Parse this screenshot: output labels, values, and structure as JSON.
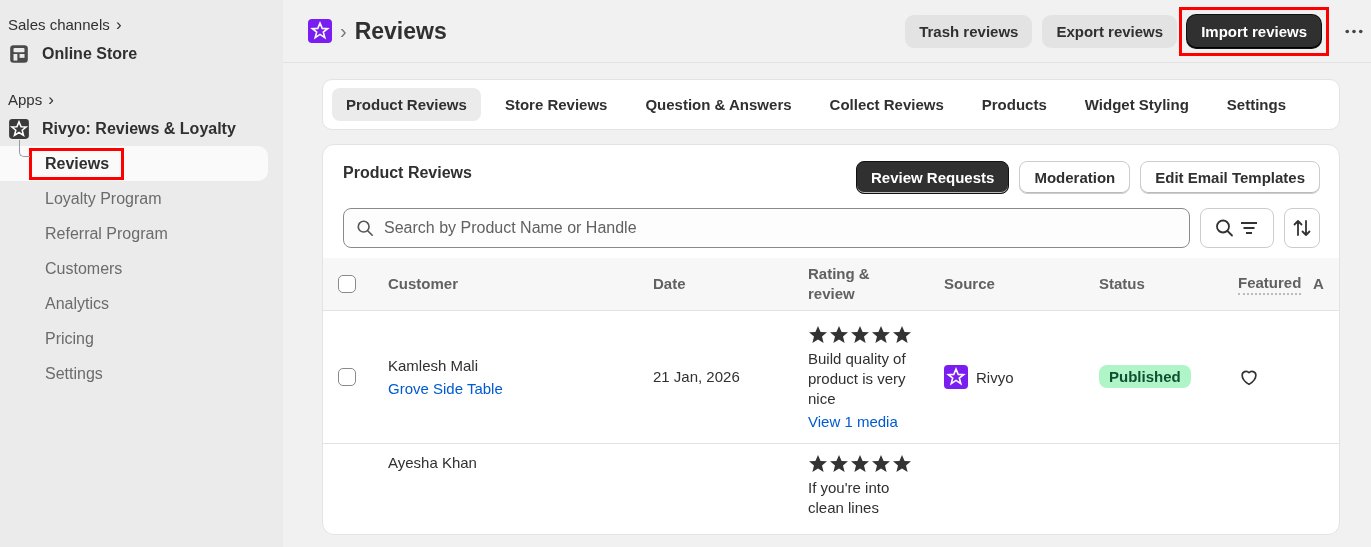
{
  "sidebar": {
    "sales_channels": {
      "label": "Sales channels",
      "chevron": "›"
    },
    "channels": [
      {
        "label": "Online Store"
      }
    ],
    "apps": {
      "label": "Apps",
      "chevron": "›"
    },
    "app": {
      "label": "Rivyo: Reviews & Loyalty"
    },
    "items": [
      {
        "label": "Reviews",
        "selected": true,
        "highlighted": true
      },
      {
        "label": "Loyalty Program",
        "selected": false,
        "highlighted": false
      },
      {
        "label": "Referral Program",
        "selected": false,
        "highlighted": false
      },
      {
        "label": "Customers",
        "selected": false,
        "highlighted": false
      },
      {
        "label": "Analytics",
        "selected": false,
        "highlighted": false
      },
      {
        "label": "Pricing",
        "selected": false,
        "highlighted": false
      },
      {
        "label": "Settings",
        "selected": false,
        "highlighted": false
      }
    ]
  },
  "header": {
    "separator": "›",
    "title": "Reviews",
    "buttons": [
      {
        "label": "Trash reviews",
        "primary": false,
        "highlighted": false
      },
      {
        "label": "Export reviews",
        "primary": false,
        "highlighted": false
      },
      {
        "label": "Import reviews",
        "primary": true,
        "highlighted": true
      }
    ]
  },
  "tabs": [
    {
      "label": "Product Reviews",
      "selected": true
    },
    {
      "label": "Store Reviews",
      "selected": false
    },
    {
      "label": "Question & Answers",
      "selected": false
    },
    {
      "label": "Collect Reviews",
      "selected": false
    },
    {
      "label": "Products",
      "selected": false
    },
    {
      "label": "Widget Styling",
      "selected": false
    },
    {
      "label": "Settings",
      "selected": false
    }
  ],
  "card": {
    "title": "Product Reviews",
    "buttons": [
      {
        "label": "Review Requests",
        "primary": true
      },
      {
        "label": "Moderation",
        "primary": false
      },
      {
        "label": "Edit Email Templates",
        "primary": false
      }
    ],
    "search": {
      "placeholder": "Search by Product Name or Handle"
    },
    "table": {
      "select_all": {
        "checked": false
      },
      "columns": [
        "Customer",
        "Date",
        "Rating & review",
        "Source",
        "Status",
        "Featured",
        "A"
      ],
      "rows": [
        {
          "checked": false,
          "customer": "Kamlesh Mali",
          "product": "Grove Side Table",
          "date": "21 Jan, 2026",
          "stars": 5,
          "review": "Build quality of product is very nice",
          "media": "View 1 media",
          "source": "Rivyo",
          "status": "Published",
          "featured": false
        },
        {
          "customer": "Ayesha Khan",
          "stars": 5,
          "review": "If you're into clean lines"
        }
      ]
    }
  }
}
